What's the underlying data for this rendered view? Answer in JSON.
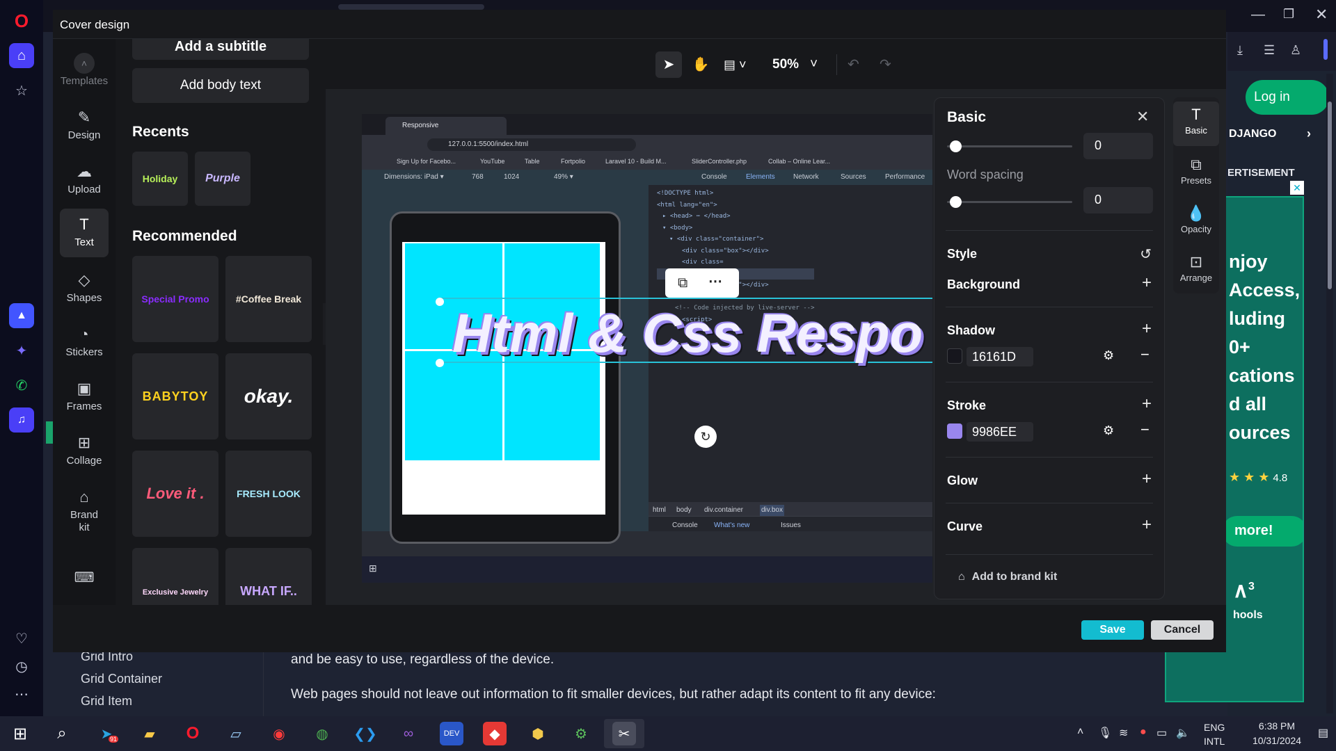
{
  "modal": {
    "title": "Cover design"
  },
  "rail": {
    "items": [
      {
        "label": "Templates",
        "icon": "chevron-up-icon"
      },
      {
        "label": "Design",
        "icon": "design-icon"
      },
      {
        "label": "Upload",
        "icon": "upload-icon"
      },
      {
        "label": "Text",
        "icon": "text-icon"
      },
      {
        "label": "Shapes",
        "icon": "shapes-icon"
      },
      {
        "label": "Stickers",
        "icon": "stickers-icon"
      },
      {
        "label": "Frames",
        "icon": "frames-icon"
      },
      {
        "label": "Collage",
        "icon": "collage-icon"
      },
      {
        "label": "Brand kit",
        "icon": "brand-kit-icon"
      }
    ]
  },
  "panel": {
    "add_subtitle": "Add a subtitle",
    "add_body": "Add body text",
    "recents_title": "Recents",
    "recents": [
      "Holiday",
      "Purple"
    ],
    "recommended_title": "Recommended",
    "recommended": [
      "Special Promo",
      "#Coffee Break",
      "BABYTOY",
      "okay.",
      "Love it .",
      "FRESH LOOK",
      "Exclusive Jewelry",
      "WHAT IF.."
    ]
  },
  "toolbar": {
    "zoom": "50%"
  },
  "canvas": {
    "headline": "Html & Css Respo",
    "tab_title": "Responsive",
    "url": "127.0.0.1:5500/index.html",
    "bookmarks": [
      "Sign Up for Facebo...",
      "YouTube",
      "Table",
      "Fortpolio",
      "Laravel 10 - Build M...",
      "SliderController.php",
      "Collab – Online Lear..."
    ],
    "device": "Dimensions: iPad ▾",
    "width": "768",
    "height": "1024",
    "scale": "49% ▾",
    "devtools_tabs": [
      "Console",
      "Elements",
      "Network",
      "Sources",
      "Performance"
    ],
    "code_lines": [
      "<!DOCTYPE html>",
      "<html lang=\"en\">",
      "▸ <head> ⋯ </head>",
      "▾ <body>",
      "▾ <div class=\"container\">",
      "<div class=\"box\"></div>",
      "<div class=",
      "<div class=",
      "<div class=\"box\"></div>",
      "</div>",
      "<!-- Code injected by live-server -->",
      "<script>"
    ],
    "breadcrumbs": [
      "html",
      "body",
      "div.container",
      "div.box"
    ],
    "drawer_tabs": [
      "Console",
      "What's new",
      "Issues"
    ]
  },
  "basic_panel": {
    "title": "Basic",
    "letter_value": "0",
    "word_spacing_label": "Word spacing",
    "word_spacing_value": "0",
    "style_label": "Style",
    "background_label": "Background",
    "shadow_label": "Shadow",
    "shadow_color": "16161D",
    "stroke_label": "Stroke",
    "stroke_color": "9986EE",
    "glow_label": "Glow",
    "curve_label": "Curve",
    "add_brand_kit": "Add to brand kit",
    "colors": {
      "shadow": "#16161D",
      "stroke": "#9986EE"
    }
  },
  "right_rail": [
    "Basic",
    "Presets",
    "Opacity",
    "Arrange"
  ],
  "footer": {
    "save": "Save",
    "cancel": "Cancel"
  },
  "background_page": {
    "login": "Log in",
    "django": "DJANGO",
    "advert": "ERTISEMENT",
    "ad_lines": [
      "njoy",
      "Access,",
      "luding",
      "0+",
      "cations",
      "d all",
      "ources"
    ],
    "rating": "4.8",
    "more": "more!",
    "schools": "hools",
    "nav_items": [
      "Grid Intro",
      "Grid Container",
      "Grid Item"
    ],
    "para1": "and be easy to use, regardless of the device.",
    "para2": "Web pages should not leave out information to fit smaller devices, but rather adapt its content to fit any device:"
  },
  "taskbar": {
    "lang1": "ENG",
    "lang2": "INTL",
    "time": "6:38 PM",
    "date": "10/31/2024",
    "badge": "91"
  }
}
